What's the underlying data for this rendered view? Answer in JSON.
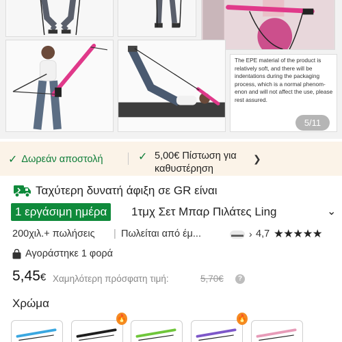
{
  "gallery": {
    "note_text": "The EPE material of the product is relatively soft, and there will be indentations during the packaging process, which is a normal phenom-enon and will not affect the use, please rest assured.",
    "counter": "5/11"
  },
  "shipping_strip": {
    "free_shipping": "Δωρεάν αποστολή",
    "delay_credit": "5,00€ Πίστωση για καθυστέρηση"
  },
  "delivery": {
    "fastest_text": "Ταχύτερη δυνατή άφιξη σε GR είναι",
    "days_badge": "1 εργάσιμη ημέρα",
    "product_title": "1τμχ Σετ Μπαρ Πιλάτες Ling"
  },
  "stats": {
    "sold": "200χιλ.+ πωλήσεις",
    "separator": "|",
    "seller": "Πωλείται από έμ...",
    "rating": "4,7",
    "stars": "★★★★★"
  },
  "bought": {
    "text": "Αγοράστηκε 1 φορά"
  },
  "price": {
    "amount": "5,45",
    "currency": "€",
    "lowest_label": "Χαμηλότερη πρόσφατη τιμή:",
    "old_price": "5,70€",
    "help": "?"
  },
  "color": {
    "label": "Χρώμα",
    "swatch_colors": [
      "#3aa7e0",
      "#1d1d1d",
      "#6fc63a",
      "#7d57c9",
      "#e79bb8"
    ],
    "hot_badges": [
      false,
      true,
      false,
      true,
      false
    ]
  },
  "colors": {
    "accent_green": "#0f8a3b",
    "strip_bg": "#fbf3e8",
    "pink_bar": "#e0398a"
  }
}
